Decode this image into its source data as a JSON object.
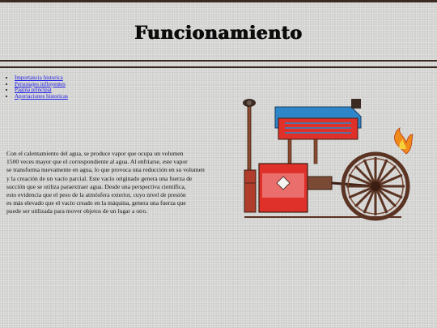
{
  "page": {
    "title": "Funcionamiento"
  },
  "nav": {
    "links": [
      "Importancia historica",
      "Personajes influyentes",
      "Pagina principal",
      "Aportaciones historicas"
    ]
  },
  "content": {
    "lines": [
      "Con el calentamiento del agua, se produce vapor que ocupa un volumen",
      "1500 veces mayor que el correspondiente al agua. Al enfriarse, este vapor",
      "se transforma nuevamente en agua, lo que provoca una reducción en su volumen",
      "y la creación de un vacío parcial. Este vacío originado genera una fuerza de",
      "succión que se utiliza paraextraer agua. Desde una perspectiva científica,",
      "esto evidencia que el peso de la atmósfera exterior, cuyo nivel de presión",
      "es más elevado que el vacío creado en la máquina, genera una fuerza que",
      "puede ser utilizada para mover objetos de un lugar a otro."
    ]
  },
  "illustration": {
    "icon": "steam-engine-illustration",
    "colors": {
      "boiler": "#e0302a",
      "tank": "#2e86c8",
      "flame": "#f08a1a",
      "wheel": "#5a3322"
    }
  }
}
